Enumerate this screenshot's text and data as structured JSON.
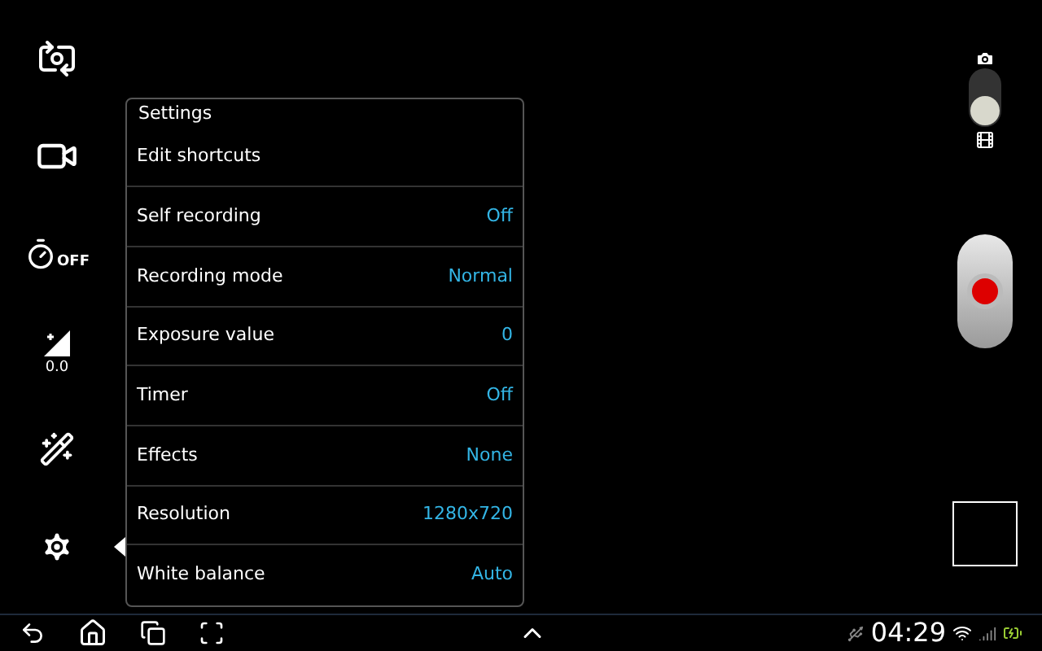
{
  "sidebar": {
    "items": [
      {
        "kind": "switch-camera",
        "selected": false
      },
      {
        "kind": "recording",
        "selected": false
      },
      {
        "kind": "timer",
        "label": "OFF",
        "selected": false
      },
      {
        "kind": "exposure",
        "label": "0.0",
        "selected": false
      },
      {
        "kind": "effects",
        "selected": false
      },
      {
        "kind": "settings",
        "selected": true
      }
    ]
  },
  "settings_panel": {
    "title": "Settings",
    "rows": [
      {
        "label": "Edit shortcuts"
      },
      {
        "label": "Self recording",
        "value": "Off"
      },
      {
        "label": "Recording mode",
        "value": "Normal"
      },
      {
        "label": "Exposure value",
        "value": "0"
      },
      {
        "label": "Timer",
        "value": "Off"
      },
      {
        "label": "Effects",
        "value": "None"
      },
      {
        "label": "Resolution",
        "value": "1280x720"
      },
      {
        "label": "White balance",
        "value": "Auto"
      }
    ]
  },
  "mode_switch": {
    "video": true
  },
  "status_bar": {
    "time": "04:29"
  }
}
